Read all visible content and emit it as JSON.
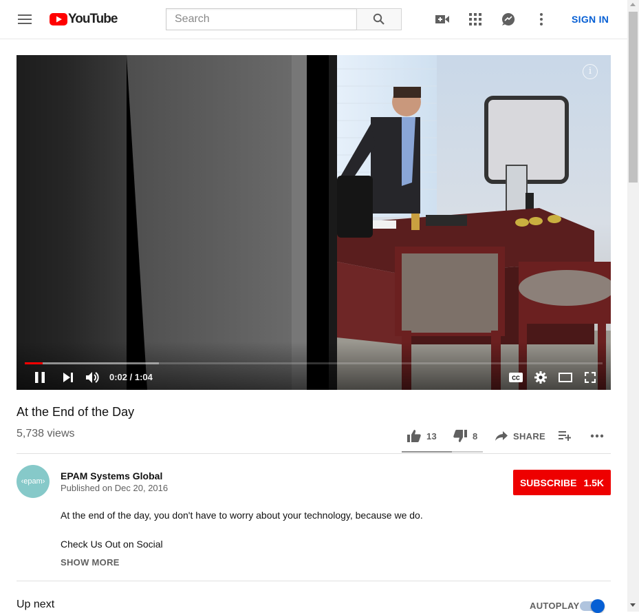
{
  "header": {
    "logo_text": "YouTube",
    "search_placeholder": "Search",
    "sign_in": "SIGN IN",
    "icons": [
      "menu-icon",
      "search-icon",
      "create-video-icon",
      "apps-grid-icon",
      "messages-icon",
      "more-vert-icon"
    ]
  },
  "player": {
    "current_time": "0:02",
    "duration": "1:04",
    "time_display": "0:02 / 1:04",
    "played_fraction": 0.031,
    "buffered_fraction": 0.232,
    "info_glyph": "i",
    "controls": [
      "pause-icon",
      "next-icon",
      "volume-icon",
      "captions-icon",
      "settings-icon",
      "theater-mode-icon",
      "fullscreen-icon"
    ]
  },
  "video": {
    "title": "At the End of the Day",
    "views": "5,738 views",
    "likes": "13",
    "dislikes": "8",
    "like_fraction": 0.62,
    "share_label": "SHARE"
  },
  "channel": {
    "avatar_text": "‹epam›",
    "name": "EPAM Systems Global",
    "published": "Published on Dec 20, 2016",
    "subscribe_label": "SUBSCRIBE",
    "subscriber_count": "1.5K"
  },
  "description": {
    "line1": "At the end of the day, you don't have to worry about your technology, because we do.",
    "line2": "Check Us Out on Social",
    "show_more": "SHOW MORE"
  },
  "sidebar": {
    "up_next": "Up next",
    "autoplay_label": "AUTOPLAY",
    "autoplay_on": true
  },
  "colors": {
    "brand_red": "#ff0000",
    "link_blue": "#065fd4",
    "subscribe_red": "#ee0000",
    "avatar_teal": "#86c9c9"
  }
}
